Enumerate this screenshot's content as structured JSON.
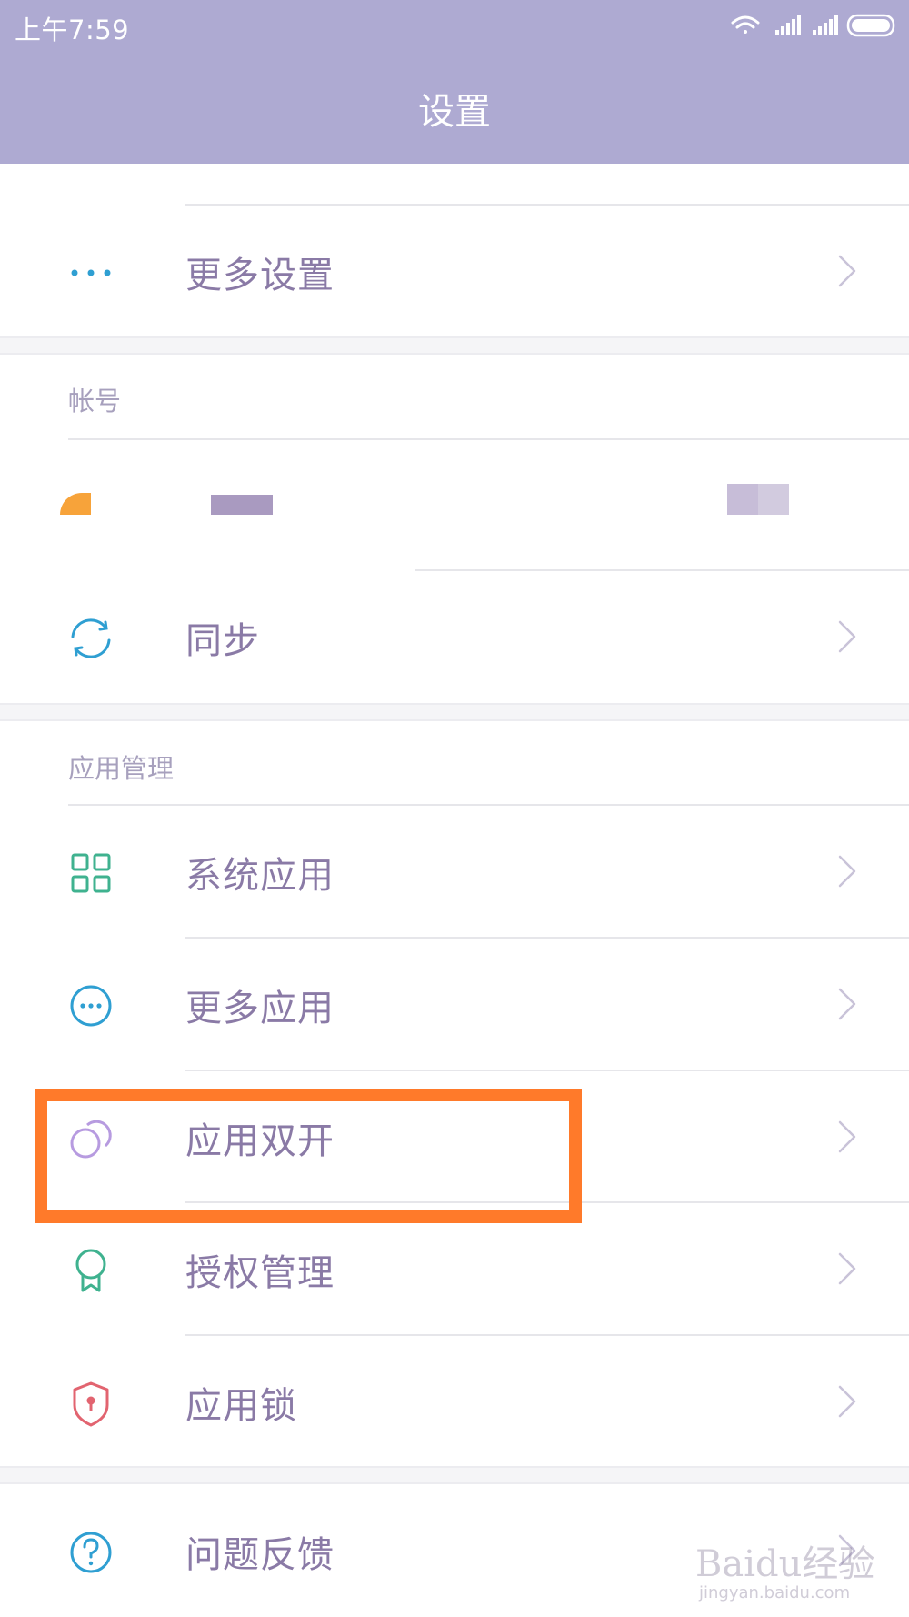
{
  "status_bar": {
    "time": "上午7:59",
    "icons": [
      "wifi-icon",
      "signal-icon",
      "signal-icon",
      "battery-icon"
    ]
  },
  "header": {
    "title": "设置"
  },
  "rows": {
    "more_settings": {
      "label": "更多设置",
      "icon": "more-dots-icon"
    },
    "sync": {
      "label": "同步",
      "icon": "sync-icon"
    },
    "system_apps": {
      "label": "系统应用",
      "icon": "grid-icon"
    },
    "more_apps": {
      "label": "更多应用",
      "icon": "more-circle-icon"
    },
    "dual_apps": {
      "label": "应用双开",
      "icon": "dual-circle-icon"
    },
    "permissions": {
      "label": "授权管理",
      "icon": "badge-icon"
    },
    "app_lock": {
      "label": "应用锁",
      "icon": "shield-lock-icon"
    },
    "feedback": {
      "label": "问题反馈",
      "icon": "question-icon"
    }
  },
  "sections": {
    "account": "帐号",
    "app_management": "应用管理"
  },
  "colors": {
    "header_bg": "#aeaad2",
    "label_text": "#8a7aa6",
    "section_text": "#a7a0bd",
    "highlight": "#ff7a2a"
  },
  "watermark": {
    "text": "Baidu经验",
    "sub": "jingyan.baidu.com"
  }
}
